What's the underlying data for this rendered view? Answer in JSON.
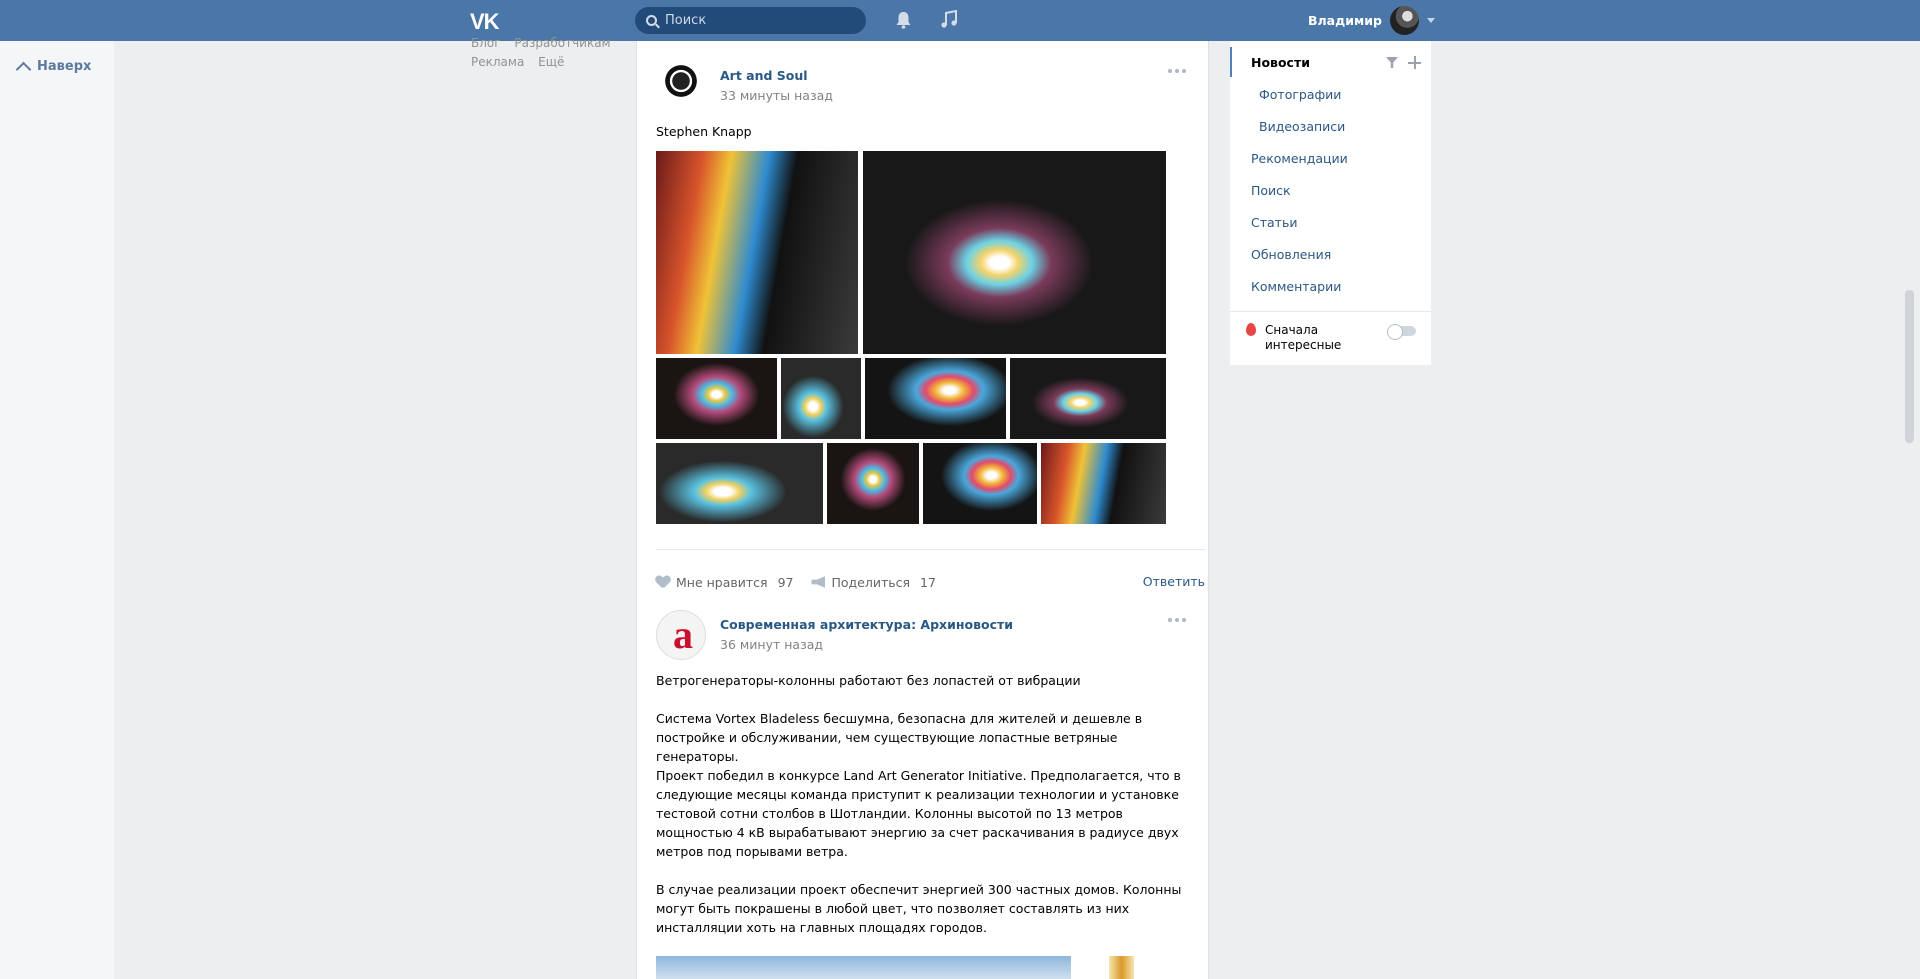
{
  "header": {
    "logo": "VK",
    "search_placeholder": "Поиск",
    "user_name": "Владимир"
  },
  "left": {
    "go_top": "Наверх",
    "footer_links": [
      "Блог",
      "Разработчикам",
      "Реклама",
      "Ещё"
    ]
  },
  "posts": [
    {
      "author": "Art and Soul",
      "time": "33 минуты назад",
      "text": "Stephen Knapp",
      "likes_label": "Мне нравится",
      "likes": "97",
      "share_label": "Поделиться",
      "shares": "17",
      "reply_label": "Ответить"
    },
    {
      "author": "Современная архитектура: Архиновости",
      "time": "36 минут назад",
      "p1": "Ветрогенераторы-колонны работают без лопастей от вибрации",
      "p2": "Система Vortex Bladeless бесшумна, безопасна для жителей и дешевле в постройке и обслуживании, чем существующие лопастные ветряные генераторы.",
      "p3": "Проект победил в конкурсе Land Art Generator Initiative. Предполагается, что в следующие месяцы команда приступит к реализации технологии и установке тестовой сотни столбов в Шотландии. Колонны высотой по 13 метров мощностью 4 кВ вырабатывают энергию за счет раскачивания в радиусе двух метров под порывами ветра.",
      "p4": "В случае реализации проект обеспечит энергией 300 частных домов. Колонны могут быть покрашены в любой цвет, что позволяет составлять из них инсталляции хоть на главных площадях городов."
    }
  ],
  "right_nav": {
    "items": [
      "Новости",
      "Фотографии",
      "Видеозаписи",
      "Рекомендации",
      "Поиск",
      "Статьи",
      "Обновления",
      "Комментарии"
    ],
    "interesting_first": "Сначала интересные"
  }
}
